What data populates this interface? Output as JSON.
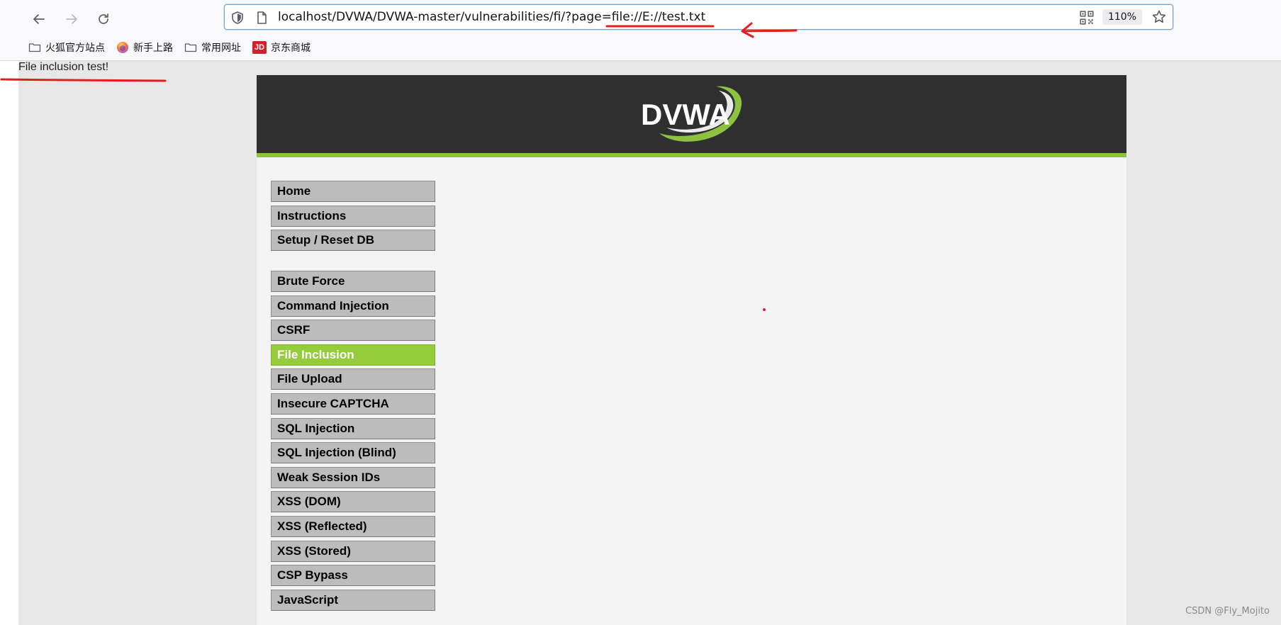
{
  "browser": {
    "url": "localhost/DVWA/DVWA-master/vulnerabilities/fi/?page=file://E://test.txt",
    "zoom": "110%",
    "bookmarks": [
      {
        "label": "火狐官方站点",
        "icon": "folder-icon"
      },
      {
        "label": "新手上路",
        "icon": "firefox-icon"
      },
      {
        "label": "常用网址",
        "icon": "folder-icon"
      },
      {
        "label": "京东商城",
        "icon": "jd-icon",
        "icon_text": "JD"
      }
    ]
  },
  "page": {
    "included_text": "File inclusion test!",
    "logo_text": "DVWA",
    "menu": {
      "group1": [
        "Home",
        "Instructions",
        "Setup / Reset DB"
      ],
      "group2": [
        "Brute Force",
        "Command Injection",
        "CSRF",
        "File Inclusion",
        "File Upload",
        "Insecure CAPTCHA",
        "SQL Injection",
        "SQL Injection (Blind)",
        "Weak Session IDs",
        "XSS (DOM)",
        "XSS (Reflected)",
        "XSS (Stored)",
        "CSP Bypass",
        "JavaScript"
      ],
      "active": "File Inclusion"
    }
  },
  "watermark": "CSDN @Fly_Mojito",
  "colors": {
    "accent_green": "#95cc3c",
    "header_dark": "#2f2f2f",
    "annotation_red": "#e02020"
  }
}
